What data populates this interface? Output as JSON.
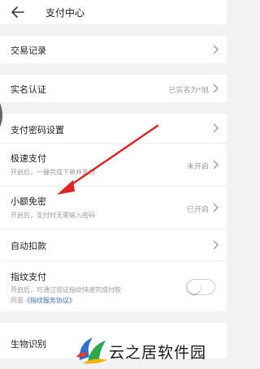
{
  "header": {
    "title": "支付中心",
    "back_icon": "back-arrow-icon"
  },
  "rows": {
    "transactions": {
      "label": "交易记录"
    },
    "realname": {
      "label": "实名认证",
      "value": "已实名为*旭"
    },
    "paypassword": {
      "label": "支付密码设置"
    },
    "fastpay": {
      "label": "极速支付",
      "sub": "开启后，一键完成下单并支付",
      "value": "未开启"
    },
    "smallfree": {
      "label": "小额免密",
      "sub": "开启后，支付时无需输入密码",
      "value": "已开启"
    },
    "autodeduct": {
      "label": "自动扣款"
    },
    "fingerprint": {
      "label": "指纹支付",
      "sub": "开启后，可通过验证指纹快速完成付款",
      "agree_prefix": "同意",
      "agree_link": "《指纹服务协议》",
      "toggle_on": false
    },
    "biometric": {
      "label": "生物识别"
    }
  },
  "watermark": {
    "text": "云之居软件园"
  },
  "colors": {
    "arrow": "#e02424",
    "link": "#3b6fb6",
    "background": "#f2f2f2"
  }
}
